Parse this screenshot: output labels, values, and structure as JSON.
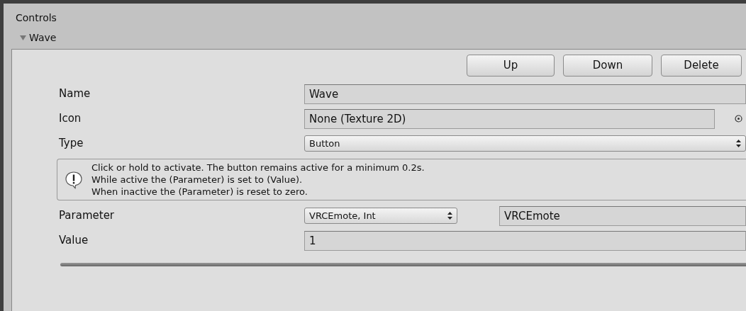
{
  "header": {
    "title": "Controls"
  },
  "foldout": {
    "label": "Wave",
    "expanded": true
  },
  "buttons": [
    "Up",
    "Down",
    "Delete"
  ],
  "rows": [
    {
      "kind": "text",
      "label": "Name",
      "value": "Wave"
    },
    {
      "kind": "object",
      "label": "Icon",
      "value": "None (Texture 2D)"
    },
    {
      "kind": "dropdown",
      "label": "Type",
      "value": "Button"
    },
    {
      "kind": "help",
      "lines": [
        "Click or hold to activate. The button remains active for a minimum 0.2s.",
        "While active the (Parameter) is set to (Value).",
        "When inactive the (Parameter) is reset to zero."
      ]
    },
    {
      "kind": "parameter",
      "label": "Parameter",
      "value": "VRCEmote, Int",
      "name": "VRCEmote"
    },
    {
      "kind": "text",
      "label": "Value",
      "value": "1"
    }
  ]
}
